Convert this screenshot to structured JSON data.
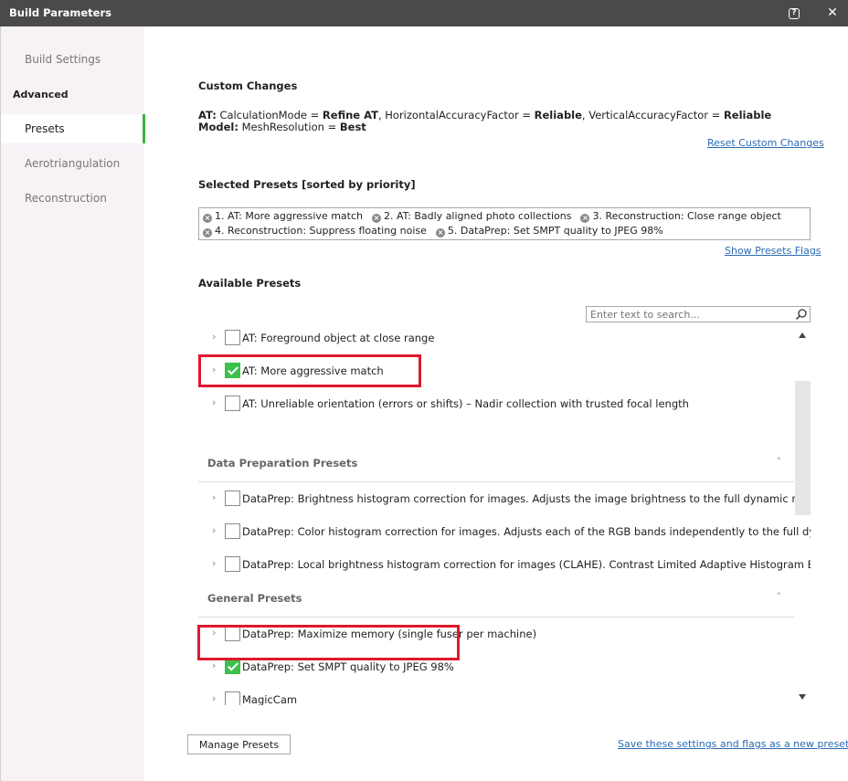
{
  "window": {
    "title": "Build Parameters",
    "help_icon": "help-icon",
    "close_icon": "close-icon",
    "close_glyph": "✕",
    "help_glyph": "?"
  },
  "sidebar": {
    "items": [
      {
        "label": "Build Settings"
      },
      {
        "label": "Advanced"
      },
      {
        "label": "Presets"
      },
      {
        "label": "Aerotriangulation"
      },
      {
        "label": "Reconstruction"
      }
    ]
  },
  "custom_changes": {
    "title": "Custom Changes",
    "line1": {
      "prefix": "AT:",
      "text1": " CalculationMode = ",
      "val1": "Refine AT",
      "text2": ", HorizontalAccuracyFactor = ",
      "val2": "Reliable",
      "text3": ", VerticalAccuracyFactor = ",
      "val3": "Reliable"
    },
    "line2": {
      "prefix": "Model:",
      "text1": " MeshResolution = ",
      "val1": "Best"
    },
    "reset_link": "Reset Custom Changes"
  },
  "selected_presets": {
    "title": "Selected Presets [sorted by priority]",
    "chips": [
      "1. AT: More aggressive match",
      "2. AT: Badly aligned photo collections",
      "3. Reconstruction: Close range object",
      "4. Reconstruction: Suppress floating noise",
      "5. DataPrep: Set SMPT quality to JPEG 98%"
    ],
    "flags_link": "Show Presets Flags"
  },
  "available_presets": {
    "title": "Available Presets",
    "search_placeholder": "Enter text to search...",
    "rows_top": [
      {
        "label": "AT: Foreground object at close range",
        "checked": false
      },
      {
        "label": "AT: More aggressive match",
        "checked": true
      },
      {
        "label": "AT: Unreliable orientation (errors or shifts) – Nadir collection with trusted focal length",
        "checked": false
      }
    ],
    "group_data_prep": {
      "title": "Data Preparation Presets",
      "rows": [
        {
          "label": "DataPrep: Brightness histogram correction for images. Adjusts the image brightness to the full dynamic range",
          "checked": false
        },
        {
          "label": "DataPrep: Color histogram correction for images. Adjusts each of the RGB bands independently to the full dynamic range",
          "checked": false
        },
        {
          "label": "DataPrep: Local brightness histogram correction for images (CLAHE). Contrast Limited Adaptive Histogram Equalization.",
          "checked": false
        }
      ]
    },
    "group_general": {
      "title": "General Presets",
      "rows": [
        {
          "label": "DataPrep: Maximize memory (single fuser per machine)",
          "checked": false
        },
        {
          "label": "DataPrep: Set SMPT quality to JPEG 98%",
          "checked": true
        },
        {
          "label": "MagicCam",
          "checked": false
        }
      ]
    },
    "chevron_glyph": "›",
    "collapse_glyph": "˄"
  },
  "footer": {
    "manage_button": "Manage Presets",
    "save_link": "Save these settings and flags as a new preset"
  },
  "colors": {
    "titlebar": "#4a4a4a",
    "accent_green": "#3cb043",
    "highlight_red": "#e0182d",
    "link_blue": "#2a6ab3"
  }
}
